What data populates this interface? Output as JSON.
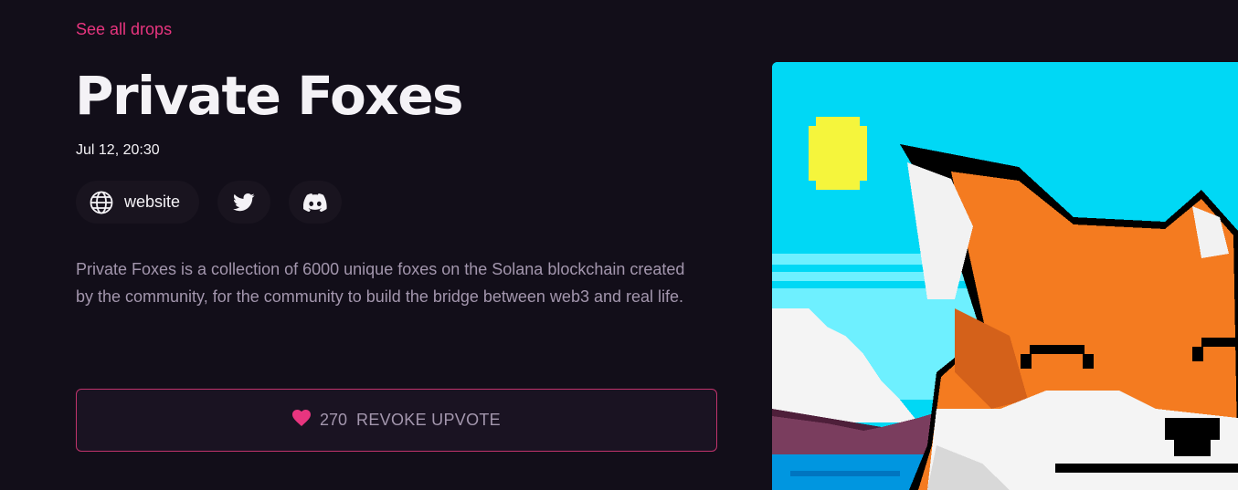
{
  "nav": {
    "back_link": "See all drops"
  },
  "drop": {
    "title": "Private Foxes",
    "date": "Jul 12, 20:30",
    "description": "Private Foxes is a collection of 6000 unique foxes on the Solana blockchain created by the community, for the community to build the bridge between web3 and real life."
  },
  "links": {
    "website_label": "website",
    "website_icon": "globe-icon",
    "twitter_icon": "twitter-icon",
    "discord_icon": "discord-icon"
  },
  "upvote": {
    "count": "270",
    "label": "REVOKE UPVOTE",
    "icon": "heart-icon"
  },
  "colors": {
    "background": "#120e19",
    "accent": "#e8357f",
    "muted_text": "#a396ad",
    "art_sky": "#00d8f5",
    "fox_orange": "#f47b20"
  }
}
